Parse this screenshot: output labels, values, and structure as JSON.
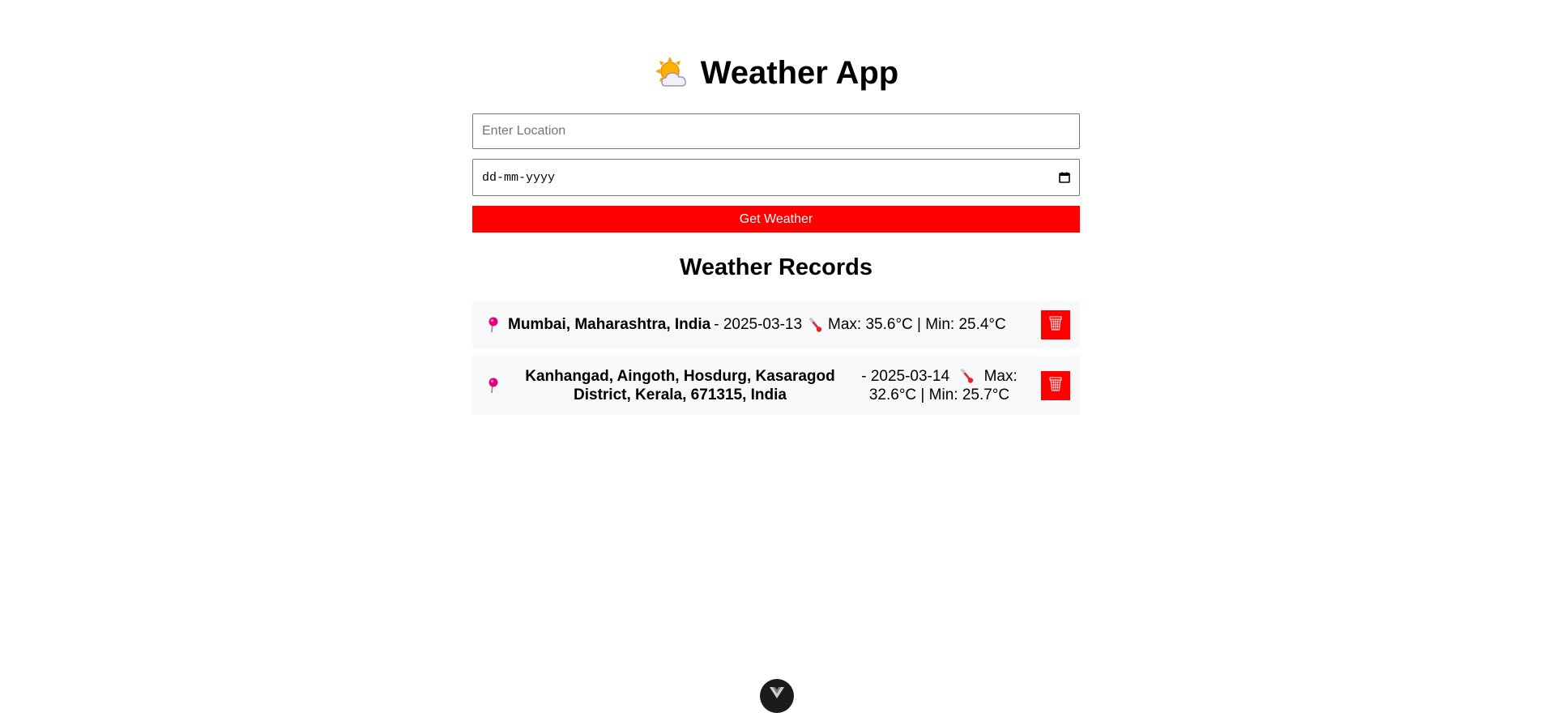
{
  "app": {
    "title": "Weather App",
    "title_icon": "sun-behind-cloud-icon"
  },
  "form": {
    "location_placeholder": "Enter Location",
    "location_value": "",
    "date_placeholder": "dd-mm-yyyy",
    "date_icon": "calendar-icon",
    "submit_label": "Get Weather",
    "submit_color": "#ff0000"
  },
  "records": {
    "heading": "Weather Records",
    "items": [
      {
        "location": "Mumbai, Maharashtra, India",
        "detail": "- 2025-03-13",
        "temps": "Max: 35.6°C | Min: 25.4°C",
        "pin_icon": "round-pushpin-icon",
        "temp_icon": "thermometer-icon",
        "delete_icon": "wastebasket-icon"
      },
      {
        "location": "Kanhangad, Aingoth, Hosdurg, Kasaragod District, Kerala, 671315, India",
        "detail": "- 2025-03-14",
        "temps": "Max: 32.6°C | Min: 25.7°C",
        "pin_icon": "round-pushpin-icon",
        "temp_icon": "thermometer-icon",
        "delete_icon": "wastebasket-icon"
      }
    ]
  },
  "colors": {
    "accent": "#ff0000",
    "record_bg": "#f7f8fa",
    "pin": "#e6007e"
  }
}
